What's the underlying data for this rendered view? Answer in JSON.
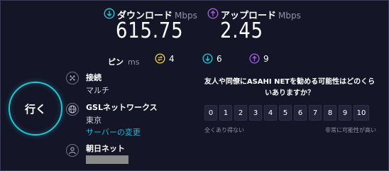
{
  "download": {
    "label": "ダウンロード",
    "unit": "Mbps",
    "value": "615.75"
  },
  "upload": {
    "label": "アップロード",
    "unit": "Mbps",
    "value": "2.45"
  },
  "ping": {
    "label": "ピン",
    "unit": "ms",
    "idle": "4",
    "download": "6",
    "upload": "9"
  },
  "go_button": {
    "label": "行く"
  },
  "connection": {
    "title": "接続",
    "value": "マルチ"
  },
  "server": {
    "name": "GSLネットワークス",
    "location": "東京",
    "change_link": "サーバーの変更"
  },
  "provider": {
    "name": "朝日ネット"
  },
  "survey": {
    "question": "友人や同僚にASAHI NETを勧める可能性はどのくらいありますか？",
    "options": [
      "0",
      "1",
      "2",
      "3",
      "4",
      "5",
      "6",
      "7",
      "8",
      "9",
      "10"
    ],
    "low_label": "全くあり得ない",
    "high_label": "非常に可能性が高い"
  },
  "colors": {
    "background": "#141526",
    "download": "#1fc7d4",
    "upload": "#a060d8",
    "idle": "#f5d142",
    "accent": "#1fb5d4"
  }
}
